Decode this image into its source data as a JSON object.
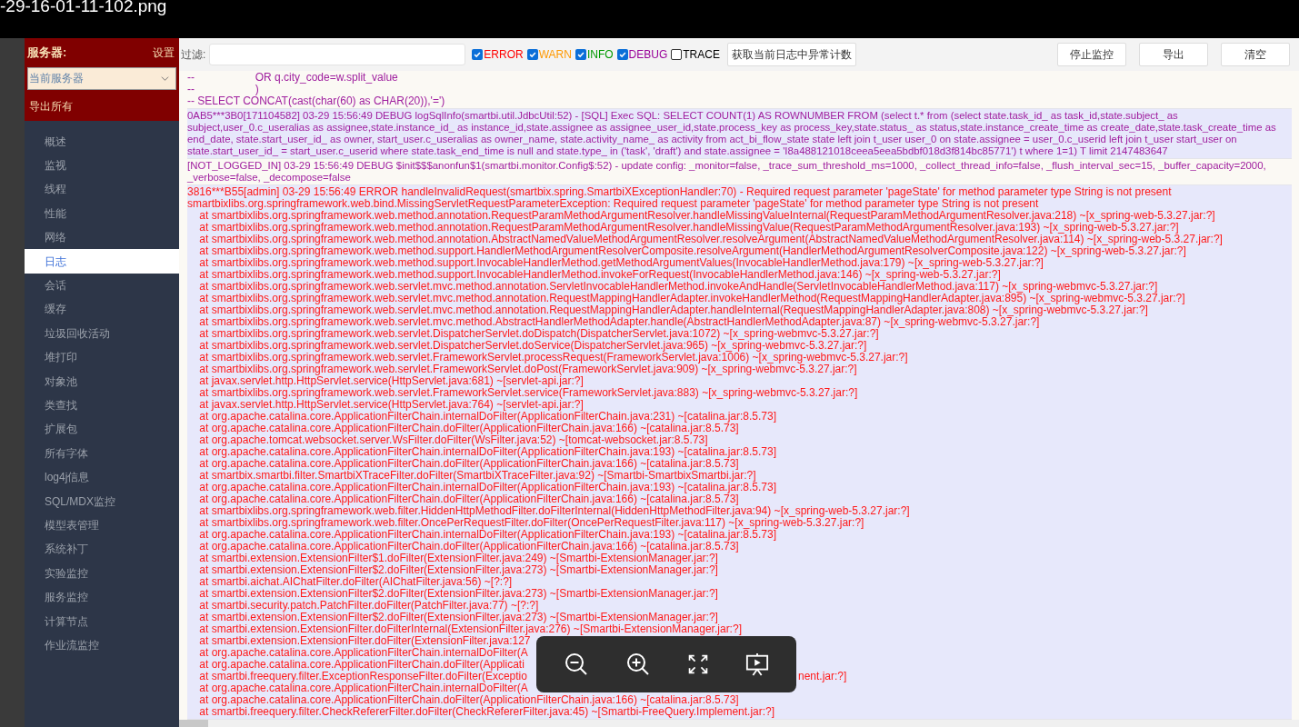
{
  "viewer": {
    "filename": "-29-16-01-11-102.png"
  },
  "sidebar": {
    "title": "服务器:",
    "settings": "设置",
    "server_select": {
      "value": "当前服务器"
    },
    "export_all": "导出所有",
    "items": [
      {
        "label": "概述",
        "selected": false
      },
      {
        "label": "监视",
        "selected": false
      },
      {
        "label": "线程",
        "selected": false
      },
      {
        "label": "性能",
        "selected": false
      },
      {
        "label": "网络",
        "selected": false
      },
      {
        "label": "日志",
        "selected": true
      },
      {
        "label": "会话",
        "selected": false
      },
      {
        "label": "缓存",
        "selected": false
      },
      {
        "label": "垃圾回收活动",
        "selected": false
      },
      {
        "label": "堆打印",
        "selected": false
      },
      {
        "label": "对象池",
        "selected": false
      },
      {
        "label": "类查找",
        "selected": false
      },
      {
        "label": "扩展包",
        "selected": false
      },
      {
        "label": "所有字体",
        "selected": false
      },
      {
        "label": "log4j信息",
        "selected": false
      },
      {
        "label": "SQL/MDX监控",
        "selected": false
      },
      {
        "label": "模型表管理",
        "selected": false
      },
      {
        "label": "系统补丁",
        "selected": false
      },
      {
        "label": "实验监控",
        "selected": false
      },
      {
        "label": "服务监控",
        "selected": false
      },
      {
        "label": "计算节点",
        "selected": false
      },
      {
        "label": "作业流监控",
        "selected": false
      }
    ]
  },
  "toolbar": {
    "filter_label": "过滤:",
    "levels": [
      {
        "label": "ERROR",
        "checked": true,
        "color": "#ff0000"
      },
      {
        "label": "WARN",
        "checked": true,
        "color": "#ff9900"
      },
      {
        "label": "INFO",
        "checked": true,
        "color": "#009900"
      },
      {
        "label": "DEBUG",
        "checked": true,
        "color": "#990099"
      },
      {
        "label": "TRACE",
        "checked": false,
        "color": "#000000"
      }
    ],
    "count_button": "获取当前日志中异常计数",
    "actions": [
      "停止监控",
      "导出",
      "清空"
    ]
  },
  "log": [
    {
      "color": "#a0209f",
      "shaded": false,
      "lines": [
        {
          "text": "--                    OR q.city_code=w.split_value"
        },
        {
          "text": "--                    )"
        },
        {
          "text": "-- SELECT CONCAT(cast(char(60) as CHAR(20)),'=')"
        }
      ]
    },
    {
      "color": "#a0209f",
      "shaded": true,
      "lines": [
        {
          "text": "0AB5***3B0[171104582] 03-29 15:56:49 DEBUG logSqlInfo(smartbi.util.JdbcUtil:52) - [SQL] Exec SQL: SELECT COUNT(1) AS ROWNUMBER FROM (select t.* from (select state.task_id_ as task_id,state.subject_ as subject,user_0.c_useralias as assignee,state.instance_id_ as instance_id,state.assignee as assignee_user_id,state.process_key as process_key,state.status_ as status,state.instance_create_time as create_date,state.task_create_time as end_date, state.start_user_id_ as owner, start_user.c_useralias as owner_name, state.activity_name_ as activity from act_bi_flow_state state left join t_user user_0 on state.assignee = user_0.c_userid left join t_user start_user on state.start_user_id_ = start_user.c_userid where state.task_end_time is null and state.type_ in ('task', 'draft') and state.assignee = 'I8a488121018ceea5eea5bdbf018d3f814bc85771') t where 1=1) T limit 2147483647"
        }
      ]
    },
    {
      "color": "#a0209f",
      "shaded": false,
      "lines": [
        {
          "text": "[NOT_LOGGED_IN] 03-29 15:56:49 DEBUG $init$$$anonfun$1(smartbi.monitor.Config$:52) - update config: _monitor=false, _trace_sum_threshold_ms=1000, _collect_thread_info=false, _flush_interval_sec=15, _buffer_capacity=2000, _verbose=false, _decompose=false"
        }
      ]
    },
    {
      "color": "#ff1a1a",
      "shaded": true,
      "lines": [
        {
          "text": "3816***B55[admin] 03-29 15:56:49 ERROR handleInvalidRequest(smartbix.spring.SmartbiXExceptionHandler:70) - Required request parameter 'pageState' for method parameter type String is not present"
        },
        {
          "text": "smartbixlibs.org.springframework.web.bind.MissingServletRequestParameterException: Required request parameter 'pageState' for method parameter type String is not present"
        },
        {
          "text": "    at smartbixlibs.org.springframework.web.method.annotation.RequestParamMethodArgumentResolver.handleMissingValueInternal(RequestParamMethodArgumentResolver.java:218) ~[x_spring-web-5.3.27.jar:?]"
        },
        {
          "text": "    at smartbixlibs.org.springframework.web.method.annotation.RequestParamMethodArgumentResolver.handleMissingValue(RequestParamMethodArgumentResolver.java:193) ~[x_spring-web-5.3.27.jar:?]"
        },
        {
          "text": "    at smartbixlibs.org.springframework.web.method.annotation.AbstractNamedValueMethodArgumentResolver.resolveArgument(AbstractNamedValueMethodArgumentResolver.java:114) ~[x_spring-web-5.3.27.jar:?]"
        },
        {
          "text": "    at smartbixlibs.org.springframework.web.method.support.HandlerMethodArgumentResolverComposite.resolveArgument(HandlerMethodArgumentResolverComposite.java:122) ~[x_spring-web-5.3.27.jar:?]"
        },
        {
          "text": "    at smartbixlibs.org.springframework.web.method.support.InvocableHandlerMethod.getMethodArgumentValues(InvocableHandlerMethod.java:179) ~[x_spring-web-5.3.27.jar:?]"
        },
        {
          "text": "    at smartbixlibs.org.springframework.web.method.support.InvocableHandlerMethod.invokeForRequest(InvocableHandlerMethod.java:146) ~[x_spring-web-5.3.27.jar:?]"
        },
        {
          "text": "    at smartbixlibs.org.springframework.web.servlet.mvc.method.annotation.ServletInvocableHandlerMethod.invokeAndHandle(ServletInvocableHandlerMethod.java:117) ~[x_spring-webmvc-5.3.27.jar:?]"
        },
        {
          "text": "    at smartbixlibs.org.springframework.web.servlet.mvc.method.annotation.RequestMappingHandlerAdapter.invokeHandlerMethod(RequestMappingHandlerAdapter.java:895) ~[x_spring-webmvc-5.3.27.jar:?]"
        },
        {
          "text": "    at smartbixlibs.org.springframework.web.servlet.mvc.method.annotation.RequestMappingHandlerAdapter.handleInternal(RequestMappingHandlerAdapter.java:808) ~[x_spring-webmvc-5.3.27.jar:?]"
        },
        {
          "text": "    at smartbixlibs.org.springframework.web.servlet.mvc.method.AbstractHandlerMethodAdapter.handle(AbstractHandlerMethodAdapter.java:87) ~[x_spring-webmvc-5.3.27.jar:?]"
        },
        {
          "text": "    at smartbixlibs.org.springframework.web.servlet.DispatcherServlet.doDispatch(DispatcherServlet.java:1072) ~[x_spring-webmvc-5.3.27.jar:?]"
        },
        {
          "text": "    at smartbixlibs.org.springframework.web.servlet.DispatcherServlet.doService(DispatcherServlet.java:965) ~[x_spring-webmvc-5.3.27.jar:?]"
        },
        {
          "text": "    at smartbixlibs.org.springframework.web.servlet.FrameworkServlet.processRequest(FrameworkServlet.java:1006) ~[x_spring-webmvc-5.3.27.jar:?]"
        },
        {
          "text": "    at smartbixlibs.org.springframework.web.servlet.FrameworkServlet.doPost(FrameworkServlet.java:909) ~[x_spring-webmvc-5.3.27.jar:?]"
        },
        {
          "text": "    at javax.servlet.http.HttpServlet.service(HttpServlet.java:681) ~[servlet-api.jar:?]"
        },
        {
          "text": "    at smartbixlibs.org.springframework.web.servlet.FrameworkServlet.service(FrameworkServlet.java:883) ~[x_spring-webmvc-5.3.27.jar:?]"
        },
        {
          "text": "    at javax.servlet.http.HttpServlet.service(HttpServlet.java:764) ~[servlet-api.jar:?]"
        },
        {
          "text": "    at org.apache.catalina.core.ApplicationFilterChain.internalDoFilter(ApplicationFilterChain.java:231) ~[catalina.jar:8.5.73]"
        },
        {
          "text": "    at org.apache.catalina.core.ApplicationFilterChain.doFilter(ApplicationFilterChain.java:166) ~[catalina.jar:8.5.73]"
        },
        {
          "text": "    at org.apache.tomcat.websocket.server.WsFilter.doFilter(WsFilter.java:52) ~[tomcat-websocket.jar:8.5.73]"
        },
        {
          "text": "    at org.apache.catalina.core.ApplicationFilterChain.internalDoFilter(ApplicationFilterChain.java:193) ~[catalina.jar:8.5.73]"
        },
        {
          "text": "    at org.apache.catalina.core.ApplicationFilterChain.doFilter(ApplicationFilterChain.java:166) ~[catalina.jar:8.5.73]"
        },
        {
          "text": "    at smartbix.smartbi.filter.SmartbiXTraceFilter.doFilter(SmartbiXTraceFilter.java:92) ~[Smartbi-SmartbixSmartbi.jar:?]"
        },
        {
          "text": "    at org.apache.catalina.core.ApplicationFilterChain.internalDoFilter(ApplicationFilterChain.java:193) ~[catalina.jar:8.5.73]"
        },
        {
          "text": "    at org.apache.catalina.core.ApplicationFilterChain.doFilter(ApplicationFilterChain.java:166) ~[catalina.jar:8.5.73]"
        },
        {
          "text": "    at smartbixlibs.org.springframework.web.filter.HiddenHttpMethodFilter.doFilterInternal(HiddenHttpMethodFilter.java:94) ~[x_spring-web-5.3.27.jar:?]"
        },
        {
          "text": "    at smartbixlibs.org.springframework.web.filter.OncePerRequestFilter.doFilter(OncePerRequestFilter.java:117) ~[x_spring-web-5.3.27.jar:?]"
        },
        {
          "text": "    at org.apache.catalina.core.ApplicationFilterChain.internalDoFilter(ApplicationFilterChain.java:193) ~[catalina.jar:8.5.73]"
        },
        {
          "text": "    at org.apache.catalina.core.ApplicationFilterChain.doFilter(ApplicationFilterChain.java:166) ~[catalina.jar:8.5.73]"
        },
        {
          "text": "    at smartbi.extension.ExtensionFilter$1.doFilter(ExtensionFilter.java:249) ~[Smartbi-ExtensionManager.jar:?]"
        },
        {
          "text": "    at smartbi.extension.ExtensionFilter$2.doFilter(ExtensionFilter.java:273) ~[Smartbi-ExtensionManager.jar:?]"
        },
        {
          "text": "    at smartbi.aichat.AIChatFilter.doFilter(AIChatFilter.java:56) ~[?:?]"
        },
        {
          "text": "    at smartbi.extension.ExtensionFilter$2.doFilter(ExtensionFilter.java:273) ~[Smartbi-ExtensionManager.jar:?]"
        },
        {
          "text": "    at smartbi.security.patch.PatchFilter.doFilter(PatchFilter.java:77) ~[?:?]"
        },
        {
          "text": "    at smartbi.extension.ExtensionFilter$2.doFilter(ExtensionFilter.java:273) ~[Smartbi-ExtensionManager.jar:?]"
        },
        {
          "text": "    at smartbi.extension.ExtensionFilter.doFilterInternal(ExtensionFilter.java:276) ~[Smartbi-ExtensionManager.jar:?]"
        },
        {
          "text": "    at smartbi.extension.ExtensionFilter.doFilter(ExtensionFilter.java:127"
        },
        {
          "text": "    at org.apache.catalina.core.ApplicationFilterChain.internalDoFilter(A"
        },
        {
          "text": "    at org.apache.catalina.core.ApplicationFilterChain.doFilter(Applicati"
        },
        {
          "text": "    at smartbi.freequery.filter.ExceptionResponseFilter.doFilter(Exceptio",
          "tail": "nent.jar:?]"
        },
        {
          "text": "    at org.apache.catalina.core.ApplicationFilterChain.internalDoFilter(A"
        },
        {
          "text": "    at org.apache.catalina.core.ApplicationFilterChain.doFilter(ApplicationFilterChain.java:166) ~[catalina.jar:8.5.73]"
        },
        {
          "text": "    at smartbi.freequery.filter.CheckRefererFilter.doFilter(CheckRefererFilter.java:45) ~[Smartbi-FreeQuery.Implement.jar:?]"
        }
      ]
    }
  ]
}
